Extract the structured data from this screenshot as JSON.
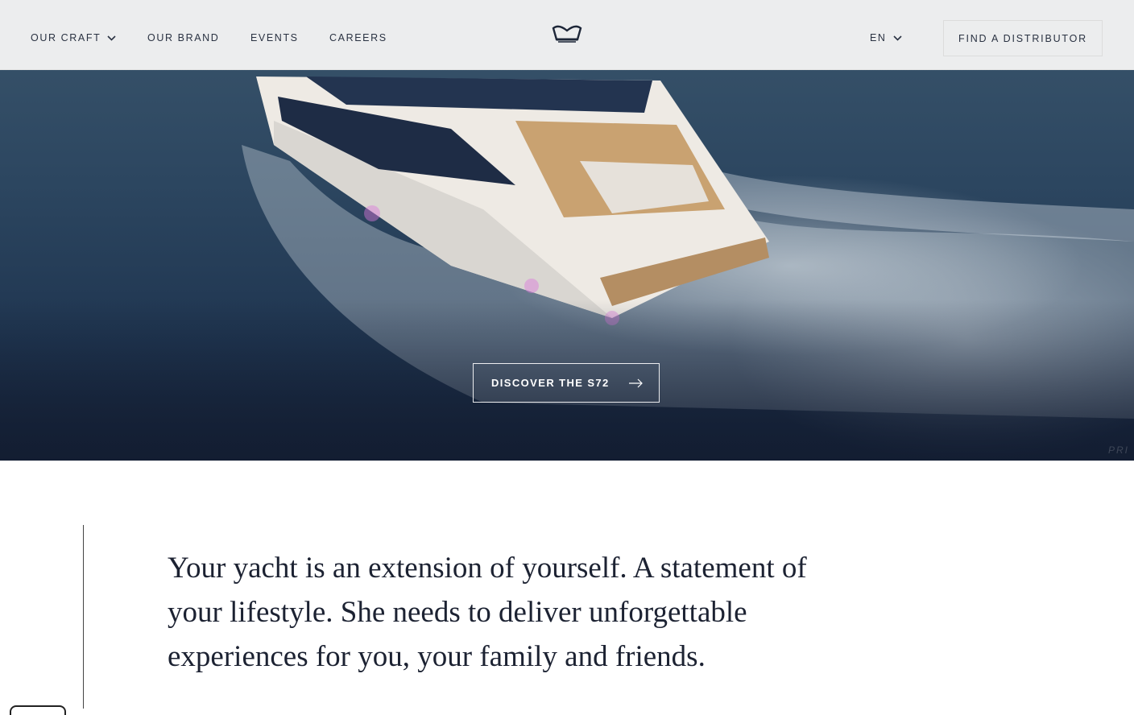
{
  "nav": {
    "items": [
      {
        "label": "OUR CRAFT",
        "has_dropdown": true
      },
      {
        "label": "OUR BRAND"
      },
      {
        "label": "EVENTS"
      },
      {
        "label": "CAREERS"
      }
    ],
    "logo_icon": "crown-icon",
    "language": "EN",
    "distributor_label": "FIND A DISTRIBUTOR"
  },
  "hero": {
    "cta_label": "DISCOVER THE S72",
    "cta_icon": "arrow-right-icon",
    "watermark": "PRI"
  },
  "statement": {
    "text": "Your yacht is an extension of yourself. A statement of your lifestyle. She needs to deliver unforgettable experiences for you, your family and friends."
  },
  "colors": {
    "header_bg": "#f4f4f4",
    "text_dark": "#1c2232",
    "sea_dark": "#17243b"
  }
}
